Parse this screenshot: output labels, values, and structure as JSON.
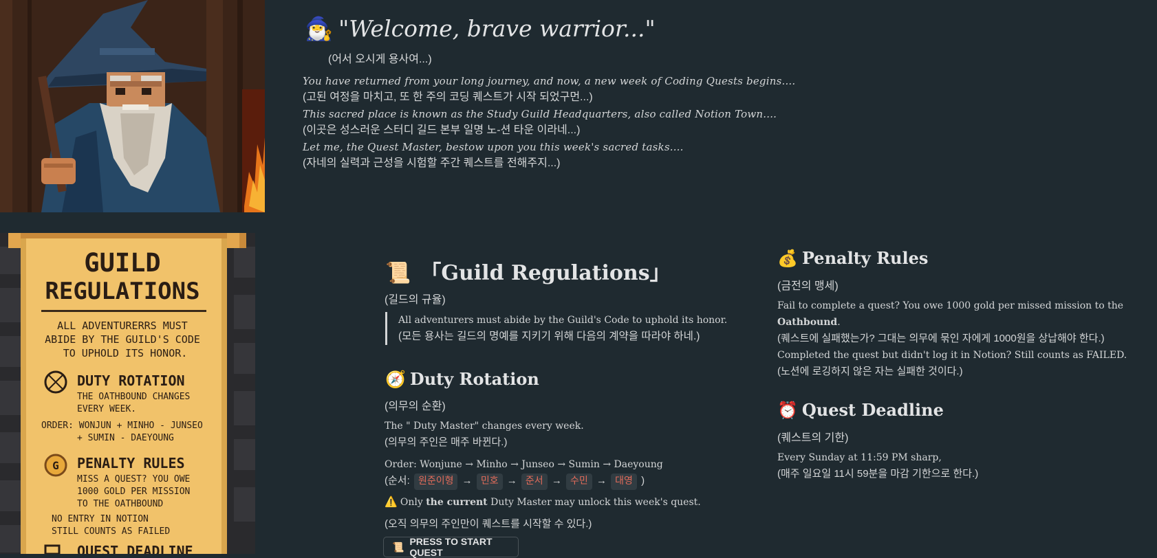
{
  "intro": {
    "icon": "wizard-emoji",
    "title": "\"Welcome, brave warrior...\"",
    "subtitle": "(어서 오시게 용사여...)",
    "lines": [
      "You have returned from your long journey, and now, a new week of Coding Quests begins....",
      "(고된 여정을 마치고, 또 한 주의 코딩 퀘스트가 시작 되었구먼...)",
      "This sacred place is known as the Study Guild Headquarters, also called Notion Town....",
      "(이곳은 성스러운 스터디 길드 본부 일명 노-션 타운 이라네...)",
      "Let me, the Quest Master, bestow upon you this week's sacred tasks....",
      "(자네의 실력과 근성을 시험할 주간 퀘스트를 전해주지...)"
    ]
  },
  "scroll_image": {
    "title_line1": "GUILD",
    "title_line2": "REGULATIONS",
    "intro": [
      "ALL ADVENTURERRS MUST",
      "ABIDE BY THE GUILD'S CODE",
      "TO UPHOLD ITS HONOR."
    ],
    "duty_title": "DUTY ROTATION",
    "duty_lines": [
      "THE OATHBOUND CHANGES",
      "EVERY WEEK."
    ],
    "order_line1": "ORDER: WONJUN + MINHO - JUNSEO",
    "order_line2": "+ SUMIN - DAEYOUNG",
    "penalty_title": "PENALTY RULES",
    "penalty_lines": [
      "MISS A QUEST? YOU OWE",
      "1000 GOLD PER MISSION",
      "TO THE OATHBOUND"
    ],
    "notion_lines": [
      "NO ENTRY IN NOTION",
      "STILL COUNTS AS FAILED"
    ],
    "deadline_title": "QUEST DEADLINE"
  },
  "regulations": {
    "icon": "scroll-emoji",
    "title": "「Guild Regulations」",
    "subtitle": "(길드의 규율)",
    "quote_en": "All adventurers must abide by the Guild's Code to uphold its honor.",
    "quote_ko": "(모든 용사는 길드의 명예를 지키기 위해 다음의 계약을 따라야 하네.)"
  },
  "duty": {
    "icon": "compass-emoji",
    "title": "Duty Rotation",
    "subtitle": "(의무의 순환)",
    "line1": "The \" Duty Master\" changes every week.",
    "line2": "(의무의 주인은 매주 바뀐다.)",
    "order_en": "Order: Wonjune → Minho → Junseo → Sumin → Daeyoung",
    "order_ko_prefix": "(순서:",
    "order_ko_suffix": ")",
    "arrow": "→",
    "names": [
      "원준이형",
      "민호",
      "준서",
      "수민",
      "대영"
    ],
    "warning_icon": "⚠️",
    "warning_pre": "Only ",
    "warning_bold": "the current",
    "warning_post": " Duty Master may unlock this week's quest.",
    "warning_ko": "(오직 의무의 주인만이 퀘스트를 시작할 수 있다.)",
    "start_button": "PRESS TO START QUEST"
  },
  "penalty": {
    "icon": "money-bag-emoji",
    "title": "Penalty Rules",
    "subtitle": "(금전의 맹세)",
    "line1_pre": "Fail to complete a quest? You owe 1000 gold per missed mission to the",
    "line1_bold": "Oathbound",
    "line1_end": ".",
    "line2": "(퀘스트에 실패했는가? 그대는 의무에 묶인 자에게 1000원을 상납해야 한다.)",
    "line3": "Completed the quest but didn't log it in Notion? Still counts as FAILED.",
    "line4": "(노션에 로깅하지 않은 자는 실패한 것이다.)"
  },
  "deadline": {
    "icon": "alarm-clock-emoji",
    "title": "Quest Deadline",
    "subtitle": "(퀘스트의 기한)",
    "line1": "Every Sunday at 11:59 PM sharp,",
    "line2": "(매주 일요일 11시 59분을 마감 기한으로 한다.)"
  },
  "colors": {
    "background": "#1f2a30",
    "text": "#d4d6d7",
    "chip_bg": "#313c42",
    "chip_text": "#e16b5a",
    "parchment": "#f1c26a"
  }
}
